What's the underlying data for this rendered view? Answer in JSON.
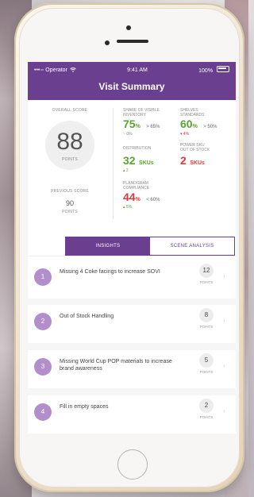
{
  "status_bar": {
    "carrier": "•••◦◦ Operator",
    "wifi_icon": "wifi-icon",
    "time": "9:41 AM",
    "battery": "100%"
  },
  "header": {
    "title": "Visit Summary"
  },
  "summary": {
    "overall_label": "OVERALL SCORE",
    "overall_value": "88",
    "overall_unit": "POINTS",
    "previous_label": "PREVIOUS SCORE",
    "previous_value": "90",
    "previous_unit": "POINTS"
  },
  "metrics": {
    "sovi": {
      "label_1": "SHARE OF VISIBLE",
      "label_2": "INVENTORY",
      "value": "75",
      "unit": "%",
      "target": "> 65%",
      "delta": "~ 0%"
    },
    "shelves": {
      "label_1": "SHELVES",
      "label_2": "STANDARDS",
      "value": "60",
      "unit": "%",
      "target": "> 50%",
      "delta": "▾ 4%"
    },
    "distribution": {
      "label_1": "DISTRIBUTION",
      "value": "32",
      "unit": "SKUs",
      "delta": "▴ 2"
    },
    "power_sku": {
      "label_1": "POWER SKU",
      "label_2": "OUT OF STOCK",
      "value": "2",
      "unit": "SKUs"
    },
    "planogram": {
      "label_1": "PLANOGRAM",
      "label_2": "COMPLIANCE",
      "value": "44",
      "unit": "%",
      "target": "< 60%",
      "delta": "▴ 5%"
    }
  },
  "tabs": {
    "insights": "INSIGHTS",
    "scene_analysis": "SCENE ANALYSIS"
  },
  "insights": [
    {
      "num": "1",
      "text": "Missing 4 Coke facings to increase SOVI",
      "points": "12",
      "unit": "POINTS"
    },
    {
      "num": "2",
      "text": "Out of Stock Handling",
      "points": "8",
      "unit": "POINTS"
    },
    {
      "num": "3",
      "text": "Missing World Cup POP materials to increase brand awareness",
      "points": "5",
      "unit": "POINTS"
    },
    {
      "num": "4",
      "text": "Fill in empty spaces",
      "points": "2",
      "unit": "POINTS"
    }
  ],
  "colors": {
    "brand": "#6a3f8f",
    "badge": "#b28fca",
    "positive": "#5aa232",
    "negative": "#d83b3b"
  }
}
